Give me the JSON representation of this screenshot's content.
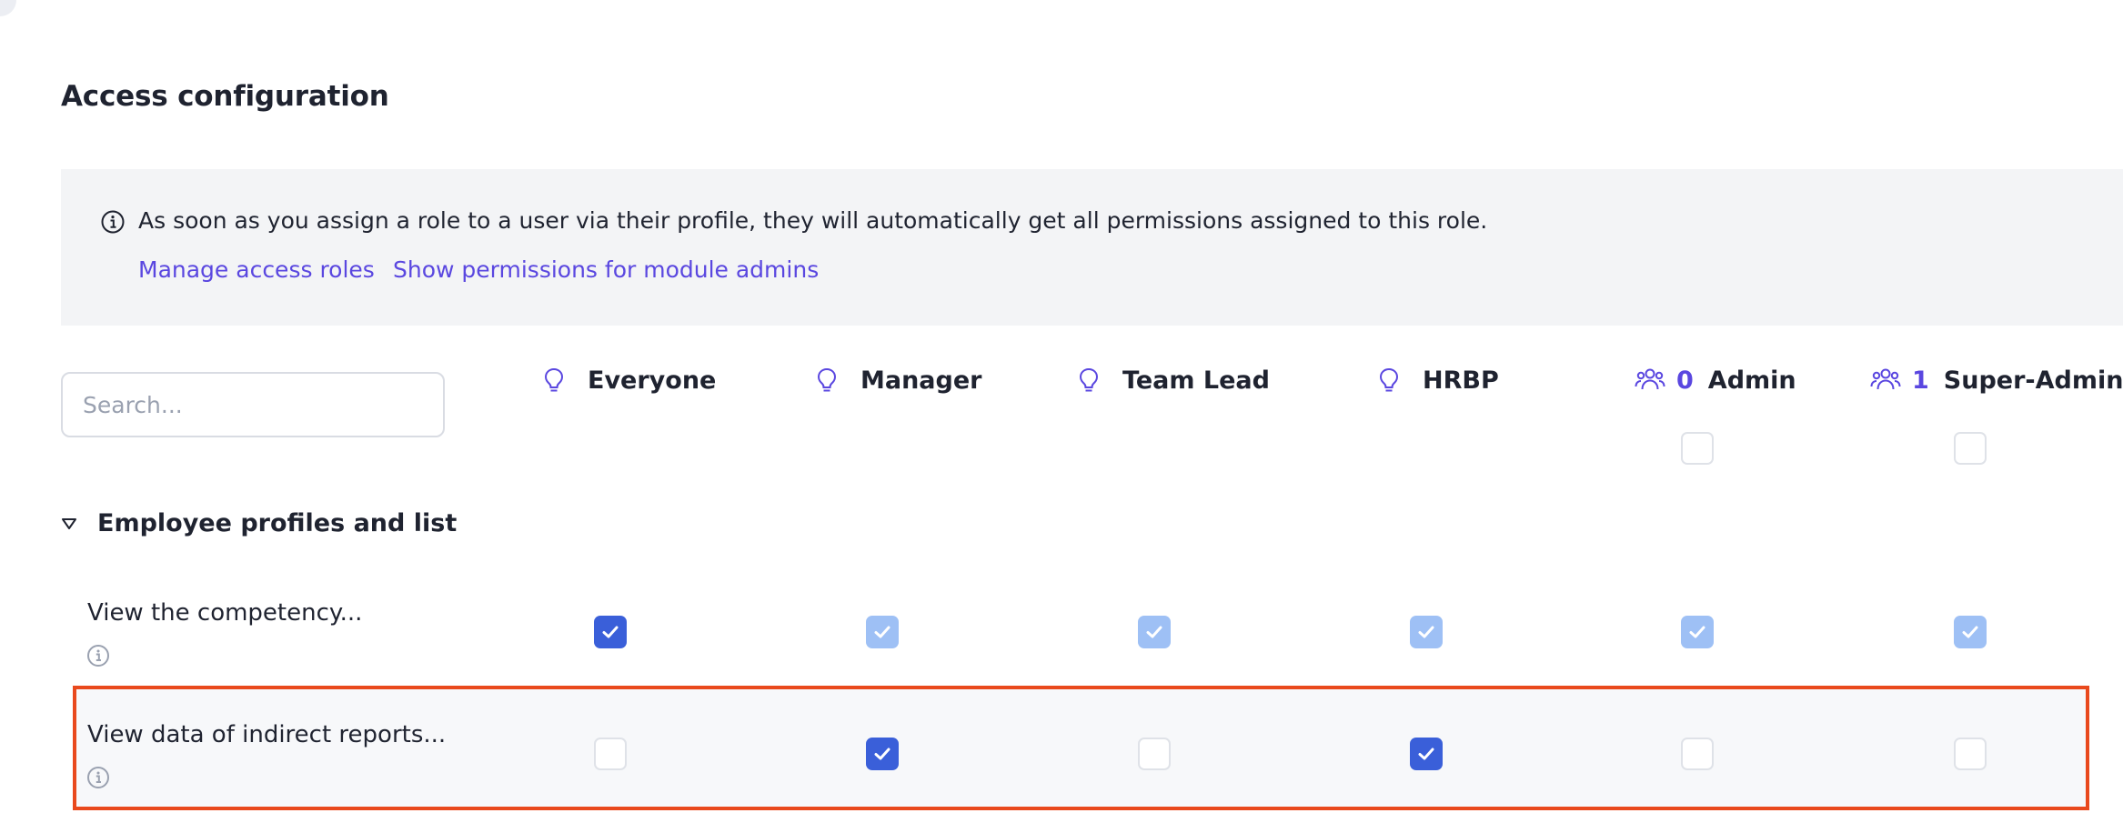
{
  "page": {
    "title": "Access configuration"
  },
  "banner": {
    "text": "As soon as you assign a role to a user via their profile, they will automatically get all permissions assigned to this role.",
    "link_manage_roles": "Manage access roles",
    "link_module_admins": "Show permissions for module admins",
    "icon": "info-icon"
  },
  "search": {
    "placeholder": "Search...",
    "value": ""
  },
  "columns": [
    {
      "label": "Everyone",
      "icon": "lightbulb-icon"
    },
    {
      "label": "Manager",
      "icon": "lightbulb-icon"
    },
    {
      "label": "Team Lead",
      "icon": "lightbulb-icon"
    },
    {
      "label": "HRBP",
      "icon": "lightbulb-icon"
    },
    {
      "label": "Admin",
      "icon": "users-group-icon",
      "count": "0"
    },
    {
      "label": "Super-Admin",
      "icon": "users-group-icon",
      "count": "1"
    }
  ],
  "section": {
    "title": "Employee profiles and list",
    "expanded": true
  },
  "rows": [
    {
      "label": "View the competency...",
      "states": [
        "checked",
        "inherited",
        "inherited",
        "inherited",
        "inherited",
        "inherited"
      ]
    },
    {
      "label": "View data of indirect reports...",
      "states": [
        "unchecked",
        "checked",
        "unchecked",
        "checked",
        "unchecked",
        "unchecked"
      ],
      "highlighted": true
    }
  ],
  "colors": {
    "accent": "#5a47e0",
    "checked": "#3a5fd9",
    "inherited": "#9ec0f5",
    "highlight_border": "#e9491d"
  }
}
